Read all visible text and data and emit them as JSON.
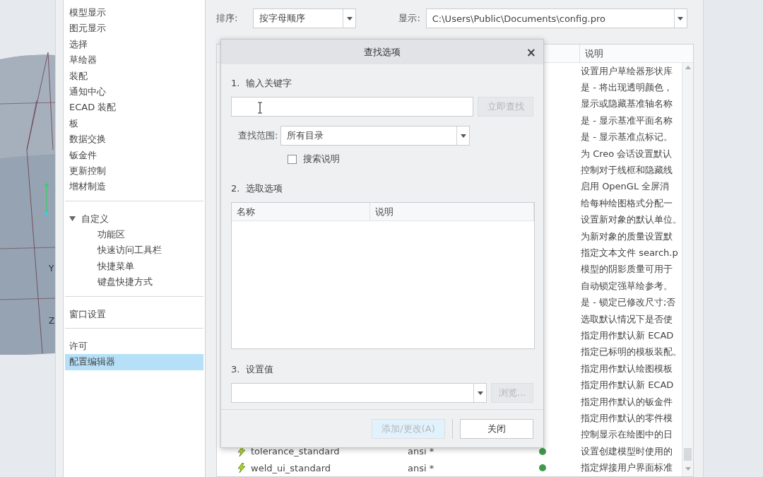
{
  "viewport": {
    "axis_labels": [
      "Y",
      "Z"
    ]
  },
  "sidebar": {
    "groups": [
      {
        "items": [
          {
            "label": "模型显示",
            "selected": false
          },
          {
            "label": "图元显示",
            "selected": false
          },
          {
            "label": "选择",
            "selected": false
          },
          {
            "label": "草绘器",
            "selected": false
          },
          {
            "label": "装配",
            "selected": false
          },
          {
            "label": "通知中心",
            "selected": false
          },
          {
            "label": "ECAD 装配",
            "selected": false
          },
          {
            "label": "板",
            "selected": false
          },
          {
            "label": "数据交换",
            "selected": false
          },
          {
            "label": "钣金件",
            "selected": false
          },
          {
            "label": "更新控制",
            "selected": false
          },
          {
            "label": "增材制造",
            "selected": false
          }
        ]
      },
      {
        "items": [
          {
            "label": "自定义",
            "selected": false,
            "expanded": true,
            "children": [
              {
                "label": "功能区",
                "selected": false
              },
              {
                "label": "快速访问工具栏",
                "selected": false
              },
              {
                "label": "快捷菜单",
                "selected": false
              },
              {
                "label": "键盘快捷方式",
                "selected": false
              }
            ]
          }
        ]
      },
      {
        "items": [
          {
            "label": "窗口设置",
            "selected": false
          }
        ]
      },
      {
        "items": [
          {
            "label": "许可",
            "selected": false
          },
          {
            "label": "配置编辑器",
            "selected": true
          }
        ]
      }
    ]
  },
  "toolbar": {
    "sort_label": "排序:",
    "sort_value": "按字母顺序",
    "show_label": "显示:",
    "show_value": "C:\\Users\\Public\\Documents\\config.pro"
  },
  "table": {
    "description_header": "说明",
    "rows": [
      {
        "description": "设置用户草绘器形状库"
      },
      {
        "description": "是 - 将出现透明颜色，"
      },
      {
        "description": "显示或隐藏基准轴名称"
      },
      {
        "description": "是 - 显示基准平面名称"
      },
      {
        "description": "是 - 显示基准点标记。"
      },
      {
        "description": "为 Creo 会话设置默认"
      },
      {
        "description": "控制对于线框和隐藏线"
      },
      {
        "description": "启用 OpenGL 全屏消"
      },
      {
        "description": "给每种绘图格式分配一"
      },
      {
        "description": "设置新对象的默认单位。"
      },
      {
        "description": "为新对象的质量设置默"
      },
      {
        "description": "指定文本文件 search.p"
      },
      {
        "description": "模型的阴影质量可用于"
      },
      {
        "description": "自动锁定强草绘参考。"
      },
      {
        "description": "是 - 锁定已修改尺寸;否"
      },
      {
        "description": "选取默认情况下是否使"
      },
      {
        "description": "指定用作默认新 ECAD"
      },
      {
        "description": "指定已标明的模板装配。"
      },
      {
        "description": "指定用作默认绘图模板"
      },
      {
        "description": "指定用作默认新 ECAD"
      },
      {
        "description": "指定用作默认的钣金件"
      },
      {
        "description": "指定用作默认的零件模"
      },
      {
        "description": "控制显示在绘图中的日"
      },
      {
        "name": "tolerance_standard",
        "value": "ansi *",
        "color": "#3f9a4e",
        "description": "设置创建模型时使用的"
      },
      {
        "name": "weld_ui_standard",
        "value": "ansi *",
        "color": "#3f9a4e",
        "description": "指定焊接用户界面标准"
      }
    ]
  },
  "dialog": {
    "title": "查找选项",
    "close": "×",
    "step1": {
      "label": "1.  输入关键字",
      "search_button": {
        "label": "立即查找",
        "disabled": true
      },
      "scope_label": "查找范围:",
      "scope_value": "所有目录",
      "search_desc": {
        "label": "搜索说明",
        "checked": false
      }
    },
    "step2": {
      "label": "2.  选取选项",
      "columns": [
        "名称",
        "说明"
      ]
    },
    "step3": {
      "label": "3.  设置值",
      "browse_button": {
        "label": "浏览...",
        "disabled": true
      }
    },
    "buttons": [
      {
        "label": "添加/更改(A)",
        "disabled": true
      },
      {
        "label": "关闭",
        "disabled": false
      }
    ]
  }
}
